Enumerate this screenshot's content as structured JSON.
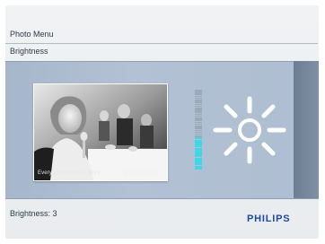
{
  "breadcrumb": "Photo Menu",
  "page_title": "Brightness",
  "photo": {
    "caption": "Every picture tells a story",
    "logo_text": "PHILIPS"
  },
  "brightness": {
    "level": 3,
    "meter_segments_total": 40,
    "meter_segments_on": 16,
    "status_text": "Brightness: 3",
    "meter_color": "#3fd6e6"
  },
  "icons": {
    "brightness": "sun-icon"
  },
  "brand": "PHILIPS",
  "colors": {
    "accent": "#3fd6e6",
    "brand": "#1b4b9a",
    "band": "#aebed1"
  }
}
